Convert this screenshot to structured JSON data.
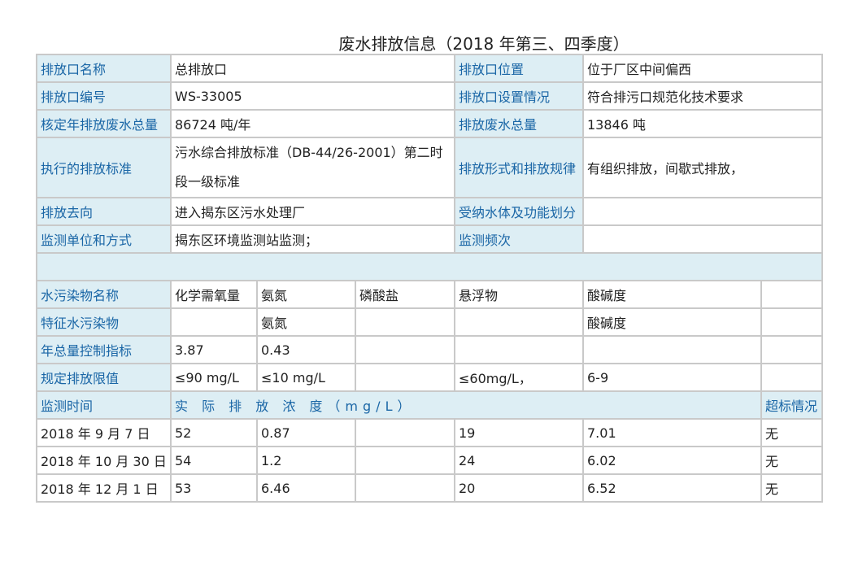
{
  "title": "废水排放信息（2018 年第三、四季度）",
  "info": {
    "outlet_name_label": "排放口名称",
    "outlet_name": "总排放口",
    "outlet_location_label": "排放口位置",
    "outlet_location": "位于厂区中间偏西",
    "outlet_code_label": "排放口编号",
    "outlet_code": "WS-33005",
    "outlet_setup_label": "排放口设置情况",
    "outlet_setup": "符合排污口规范化技术要求",
    "approved_total_label": "核定年排放废水总量",
    "approved_total": "86724 吨/年",
    "discharge_total_label": "排放废水总量",
    "discharge_total": "13846 吨",
    "standard_label": "执行的排放标准",
    "standard": "污水综合排放标准（DB-44/26-2001）第二时段一级标准",
    "form_label": "排放形式和排放规律",
    "form": "有组织排放，间歇式排放，",
    "destination_label": "排放去向",
    "destination": "进入揭东区污水处理厂",
    "receiving_label": "受纳水体及功能划分",
    "receiving": "",
    "monitor_unit_label": "监测单位和方式",
    "monitor_unit": "揭东区环境监测站监测；",
    "monitor_freq_label": "监测频次",
    "monitor_freq": ""
  },
  "pollutants": {
    "name_label": "水污染物名称",
    "names": [
      "化学需氧量",
      "氨氮",
      "磷酸盐",
      "悬浮物",
      "酸碱度",
      ""
    ],
    "feature_label": "特征水污染物",
    "features": [
      "",
      "氨氮",
      "",
      "",
      "酸碱度",
      ""
    ],
    "total_control_label": "年总量控制指标",
    "total_control": [
      "3.87",
      "0.43",
      "",
      "",
      "",
      ""
    ],
    "limit_label": "规定排放限值",
    "limits": [
      "≤90 mg/L",
      "≤10 mg/L",
      "",
      "≤60mg/L，",
      "6-9",
      ""
    ]
  },
  "monitoring": {
    "time_label": "监测时间",
    "concentration_label": "实 际 排 放 浓 度（mg/L）",
    "exceed_label": "超标情况",
    "rows": [
      {
        "date": "2018 年 9 月 7 日",
        "values": [
          "52",
          "0.87",
          "",
          "19",
          "7.01"
        ],
        "exceed": "无"
      },
      {
        "date": "2018 年 10 月 30 日",
        "values": [
          "54",
          "1.2",
          "",
          "24",
          "6.02"
        ],
        "exceed": "无"
      },
      {
        "date": "2018 年 12 月 1 日",
        "values": [
          "53",
          "6.46",
          "",
          "20",
          "6.52"
        ],
        "exceed": "无"
      }
    ]
  }
}
